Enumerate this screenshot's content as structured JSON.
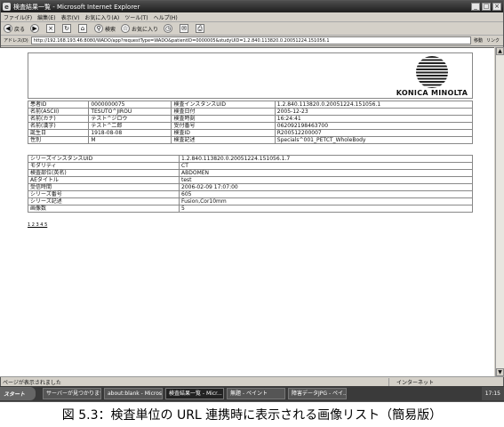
{
  "window": {
    "title": "検査結果一覧 - Microsoft Internet Explorer",
    "controls": [
      "_",
      "□",
      "×"
    ]
  },
  "menu": [
    "ファイル(F)",
    "編集(E)",
    "表示(V)",
    "お気に入り(A)",
    "ツール(T)",
    "ヘルプ(H)"
  ],
  "toolbar": {
    "back_label": "戻る",
    "search_label": "検索",
    "favorites_label": "お気に入り"
  },
  "address": {
    "label": "アドレス(D)",
    "url": "http://192.168.193.46:8080/WADO/app?requestType=WADO&patientID=0000005&studyUID=1.2.840.113820.0.20051224.151056.1",
    "go_label": "移動",
    "links_label": "リンク"
  },
  "logo": {
    "name": "KONICA MINOLTA"
  },
  "patient_rows": [
    {
      "label1": "患者ID",
      "value1": "0000000075",
      "label2": "検査インスタンスUID",
      "value2": "1.2.840.113820.0.20051224.151056.1"
    },
    {
      "label1": "名前(ASCII)",
      "value1": "TESUTO^JIROU",
      "label2": "検査日付",
      "value2": "2005-12-23"
    },
    {
      "label1": "名前(カナ)",
      "value1": "テスト^ジロウ",
      "label2": "検査時刻",
      "value2": "16:24:41"
    },
    {
      "label1": "名前(漢字)",
      "value1": "テスト^二郎",
      "label2": "受付番号",
      "value2": "062092198463700"
    },
    {
      "label1": "誕生日",
      "value1": "1918-08-08",
      "label2": "検査ID",
      "value2": "R200512200007"
    },
    {
      "label1": "性別",
      "value1": "M",
      "label2": "検査記述",
      "value2": "Specials^001_PETCT_WholeBody"
    }
  ],
  "series_rows": [
    {
      "label": "シリーズインスタンスUID",
      "value": "1.2.840.113820.0.20051224.151056.1.7"
    },
    {
      "label": "モダリティ",
      "value": "CT"
    },
    {
      "label": "検査部位(英名)",
      "value": "ABDOMEN"
    },
    {
      "label": "AEタイトル",
      "value": "test"
    },
    {
      "label": "受信時間",
      "value": "2006-02-09 17:07:00"
    },
    {
      "label": "シリーズ番号",
      "value": "605"
    },
    {
      "label": "シリーズ記述",
      "value": "Fusion,Cor10mm"
    },
    {
      "label": "画像数",
      "value": "5"
    }
  ],
  "pagination": "1 2 3 4 5",
  "status": {
    "text": "ページが表示されました",
    "zone": "インターネット"
  },
  "taskbar": {
    "start_label": "スタート",
    "tasks": [
      "サーバーが見つかりませ",
      "about:blank - Micros...",
      "検査結果一覧 - Micr...",
      "無題 - ペイント",
      "障害データJPG - ペイ..."
    ],
    "tray_time": "17:15"
  },
  "caption": "図 5.3：検査単位の URL 連携時に表示される画像リスト（簡易版）"
}
